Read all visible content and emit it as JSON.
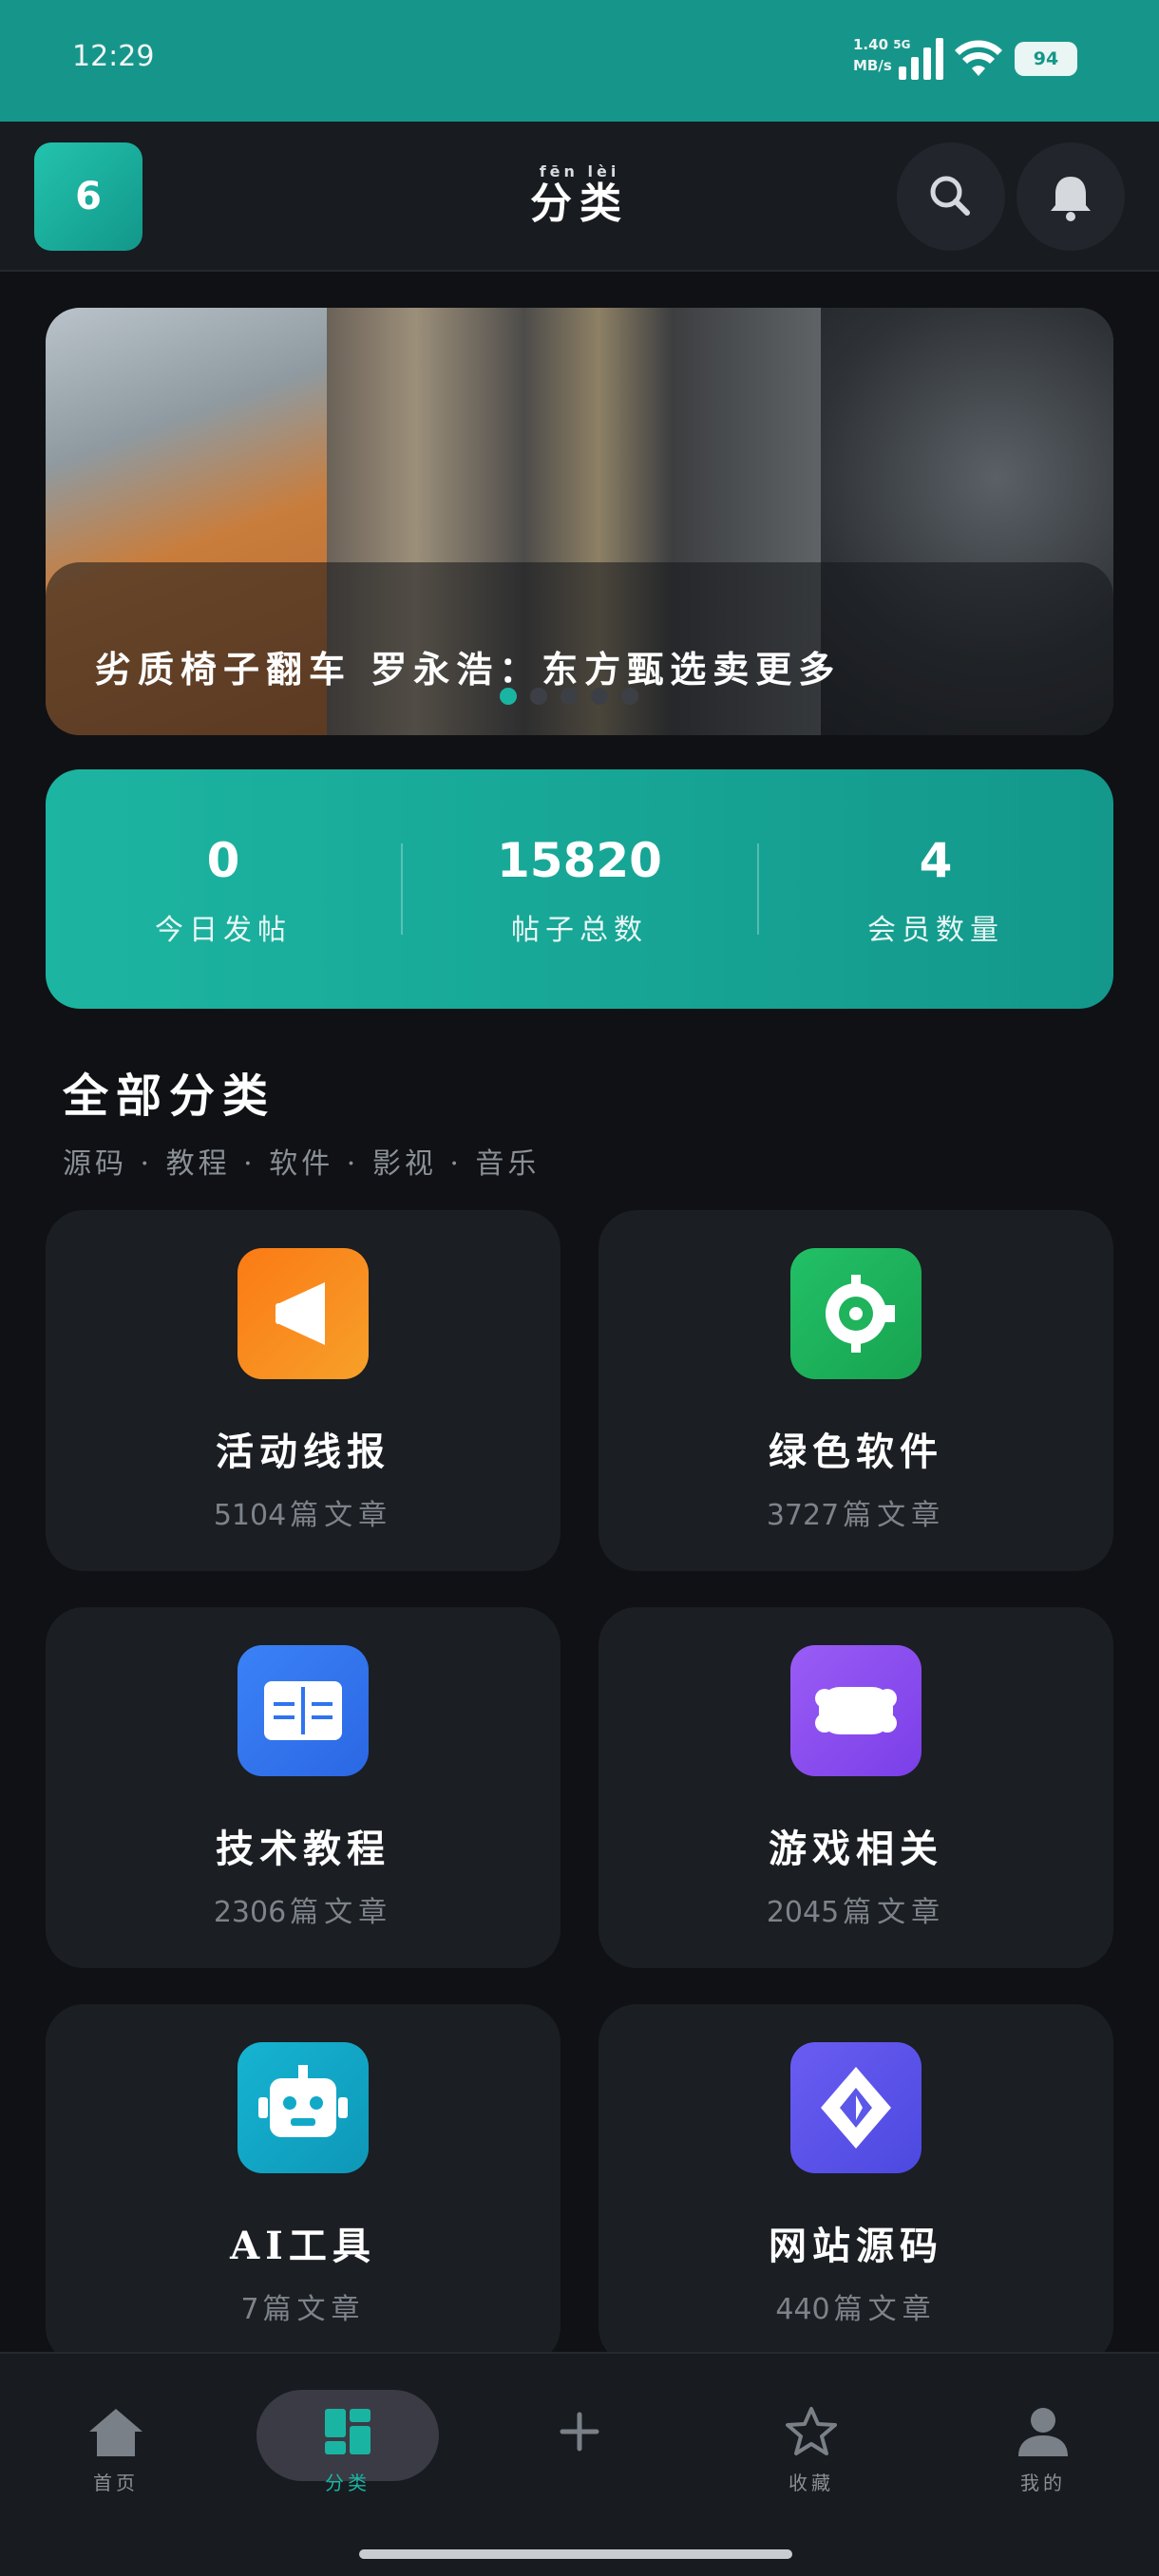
{
  "status_bar": {
    "time": "12:29",
    "network_speed": "1.40",
    "network_unit": "MB/s",
    "network_type": "5G",
    "battery": "94"
  },
  "header": {
    "logo_text": "6",
    "title_pinyin": "fēn lèi",
    "title": "分类"
  },
  "banner": {
    "caption": "劣质椅子翻车 罗永浩：东方甄选卖更多",
    "active_dot": 0,
    "dot_count": 5
  },
  "stats": [
    {
      "value": "0",
      "label": "今日发帖"
    },
    {
      "value": "15820",
      "label": "帖子总数"
    },
    {
      "value": "4",
      "label": "会员数量"
    }
  ],
  "section": {
    "title": "全部分类",
    "subtitle": "源码 · 教程 · 软件 · 影视 · 音乐"
  },
  "categories": [
    {
      "name": "活动线报",
      "count": "5104",
      "unit": "篇文章",
      "icon": "megaphone-icon",
      "color": "#f5871a"
    },
    {
      "name": "绿色软件",
      "count": "3727",
      "unit": "篇文章",
      "icon": "software-icon",
      "color": "#1fb35c"
    },
    {
      "name": "技术教程",
      "count": "2306",
      "unit": "篇文章",
      "icon": "book-icon",
      "color": "#3478f0"
    },
    {
      "name": "游戏相关",
      "count": "2045",
      "unit": "篇文章",
      "icon": "gamepad-icon",
      "color": "#8a4ff0"
    },
    {
      "name": "AI工具",
      "count": "7",
      "unit": "篇文章",
      "icon": "robot-icon",
      "color": "#12a9c8"
    },
    {
      "name": "网站源码",
      "count": "440",
      "unit": "篇文章",
      "icon": "diamond-icon",
      "color": "#5b57e8"
    }
  ],
  "bottom_nav": [
    {
      "label": "首页",
      "icon": "home-icon"
    },
    {
      "label": "分类",
      "icon": "category-icon",
      "active": true
    },
    {
      "label": "",
      "icon": "plus-icon"
    },
    {
      "label": "收藏",
      "icon": "star-icon"
    },
    {
      "label": "我的",
      "icon": "user-icon"
    }
  ],
  "colors": {
    "accent": "#1ab5a2",
    "status_bar": "#16968a",
    "background": "#0f1114",
    "card": "#1b1e22"
  }
}
